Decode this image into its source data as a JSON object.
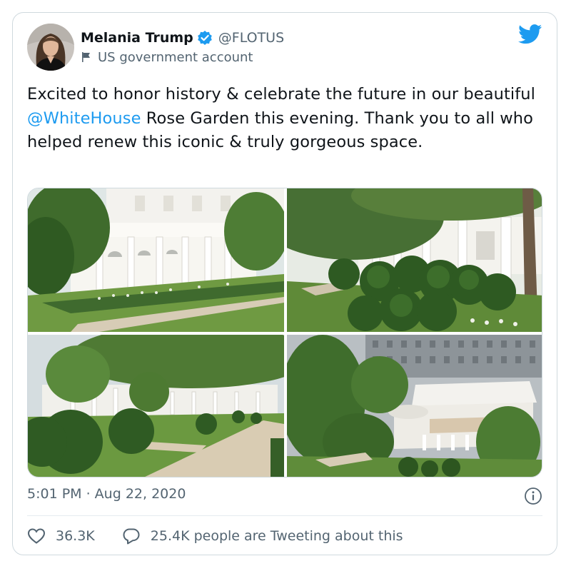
{
  "author": {
    "display_name": "Melania Trump",
    "handle": "@FLOTUS",
    "account_label": "US government account"
  },
  "tweet": {
    "text_before": "Excited to honor history & celebrate the future in our beautiful ",
    "mention": "@WhiteHouse",
    "text_after": " Rose Garden this evening. Thank you to all who helped renew this iconic & truly gorgeous space."
  },
  "meta": {
    "timestamp": "5:01 PM · Aug 22, 2020",
    "likes": "36.3K",
    "reply_text": "25.4K people are Tweeting about this"
  },
  "icons": {
    "verified": "verified-badge-icon",
    "gov": "flag-icon",
    "logo": "twitter-bird-icon",
    "info": "info-icon",
    "like": "heart-icon",
    "reply": "speech-bubble-icon"
  },
  "colors": {
    "accent": "#1d9bf0",
    "text": "#0f1419",
    "secondary": "#536471",
    "border": "#cfd9de"
  }
}
